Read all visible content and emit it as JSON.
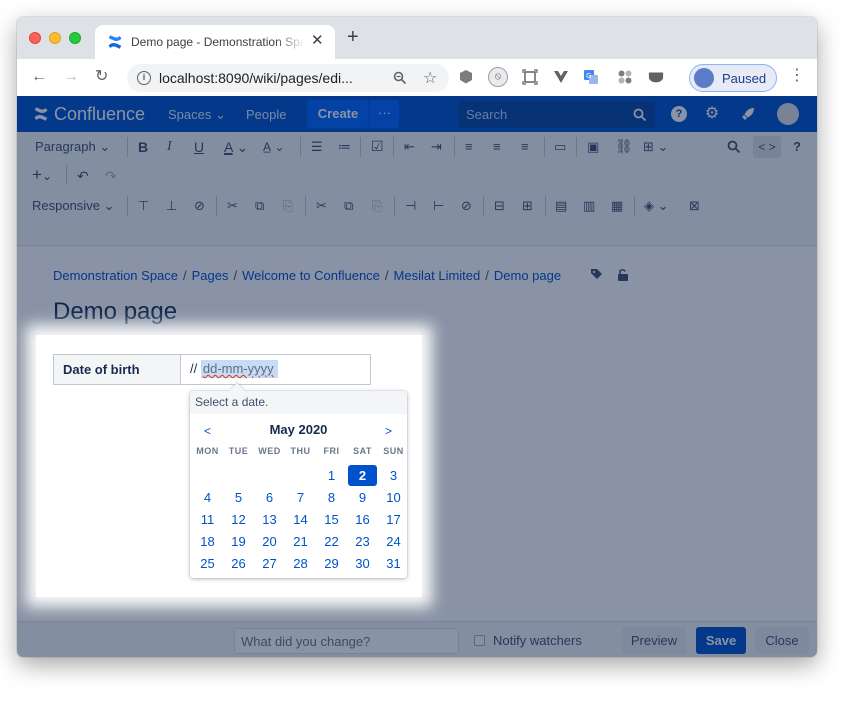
{
  "browser": {
    "tab": {
      "title": "Demo page - Demonstration Space - Confluence",
      "close_glyph": "✕"
    },
    "new_tab_glyph": "+",
    "nav": {
      "back": "←",
      "forward": "→",
      "reload": "↻"
    },
    "address": {
      "url": "localhost:8090/wiki/pages/edi..."
    },
    "profile": {
      "label": "Paused"
    },
    "colors": {
      "tab_strip": "#dee1e6",
      "profile_border": "#8ab4f8"
    }
  },
  "confluence": {
    "logo_text": "Confluence",
    "nav": {
      "spaces": "Spaces",
      "spaces_caret": "⌄",
      "people": "People",
      "create": "Create",
      "more": "···"
    },
    "search_placeholder": "Search",
    "colors": {
      "nav_bg": "#0052cc",
      "create_bg": "#0065ff",
      "link": "#0052cc"
    }
  },
  "editor_toolbar": {
    "paragraph": "Paragraph",
    "bold": "B",
    "italic": "I",
    "underline": "U",
    "text_color": "A",
    "styles": "A̲",
    "caret": "⌄",
    "source": "< >",
    "help": "?",
    "insert_plus": "+",
    "table_layout": "Responsive"
  },
  "breadcrumb": [
    "Demonstration Space",
    "Pages",
    "Welcome to Confluence",
    "Mesilat Limited",
    "Demo page"
  ],
  "breadcrumb_sep": "/",
  "page_title": "Demo page",
  "form": {
    "dob_label": "Date of birth",
    "dob_prefix": "//",
    "dob_placeholder": "dd-mm-yyyy"
  },
  "datepicker": {
    "hint": "Select a date.",
    "month_label": "May 2020",
    "prev": "<",
    "next": ">",
    "weekdays": [
      "MON",
      "TUE",
      "WED",
      "THU",
      "FRI",
      "SAT",
      "SUN"
    ],
    "weeks": [
      [
        "",
        "",
        "",
        "",
        "1",
        "2",
        "3"
      ],
      [
        "4",
        "5",
        "6",
        "7",
        "8",
        "9",
        "10"
      ],
      [
        "11",
        "12",
        "13",
        "14",
        "15",
        "16",
        "17"
      ],
      [
        "18",
        "19",
        "20",
        "21",
        "22",
        "23",
        "24"
      ],
      [
        "25",
        "26",
        "27",
        "28",
        "29",
        "30",
        "31"
      ]
    ],
    "selected_day": "2"
  },
  "bottom_bar": {
    "comment_placeholder": "What did you change?",
    "notify_label": "Notify watchers",
    "preview": "Preview",
    "save": "Save",
    "close": "Close"
  }
}
